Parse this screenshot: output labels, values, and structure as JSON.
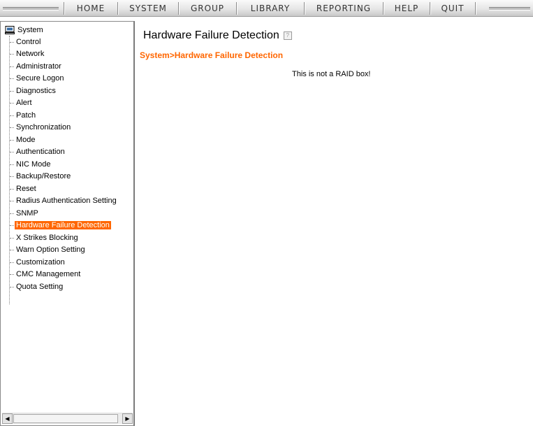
{
  "nav": {
    "items": [
      "HOME",
      "SYSTEM",
      "GROUP",
      "LIBRARY",
      "REPORTING",
      "HELP",
      "QUIT"
    ]
  },
  "sidebar": {
    "root_label": "System",
    "items": [
      {
        "label": "Control"
      },
      {
        "label": "Network"
      },
      {
        "label": "Administrator"
      },
      {
        "label": "Secure Logon"
      },
      {
        "label": "Diagnostics"
      },
      {
        "label": "Alert"
      },
      {
        "label": "Patch"
      },
      {
        "label": "Synchronization"
      },
      {
        "label": "Mode"
      },
      {
        "label": "Authentication"
      },
      {
        "label": "NIC Mode"
      },
      {
        "label": "Backup/Restore"
      },
      {
        "label": "Reset"
      },
      {
        "label": "Radius Authentication Setting"
      },
      {
        "label": "SNMP"
      },
      {
        "label": "Hardware Failure Detection",
        "selected": true
      },
      {
        "label": "X Strikes Blocking"
      },
      {
        "label": "Warn Option Setting"
      },
      {
        "label": "Customization"
      },
      {
        "label": "CMC Management"
      },
      {
        "label": "Quota Setting"
      }
    ],
    "selected_color": "#ff6600"
  },
  "main": {
    "title": "Hardware Failure Detection",
    "breadcrumb": "System>Hardware Failure Detection",
    "message": "This is not a RAID box!"
  },
  "colors": {
    "accent": "#ff6600"
  },
  "icons": {
    "root": "computer-icon",
    "help": "help-icon"
  }
}
